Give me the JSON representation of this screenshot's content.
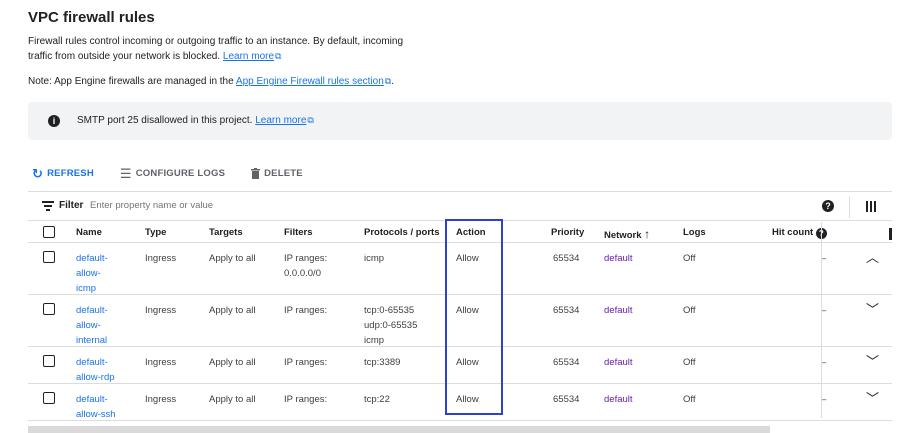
{
  "page": {
    "title": "VPC firewall rules",
    "description": "Firewall rules control incoming or outgoing traffic to an instance. By default, incoming traffic from outside your network is blocked.",
    "learn_more": "Learn more",
    "note_prefix": "Note: App Engine firewalls are managed in the",
    "note_link": "App Engine Firewall rules section",
    "note_suffix": "."
  },
  "banner": {
    "icon": "info-icon",
    "text": "SMTP port 25 disallowed in this project.",
    "link": "Learn more"
  },
  "toolbar": {
    "refresh": "REFRESH",
    "configure_logs": "CONFIGURE LOGS",
    "delete": "DELETE"
  },
  "filter": {
    "label": "Filter",
    "placeholder": "Enter property name or value"
  },
  "table": {
    "headers": {
      "name": "Name",
      "type": "Type",
      "targets": "Targets",
      "filters": "Filters",
      "protocols": "Protocols / ports",
      "action": "Action",
      "priority": "Priority",
      "network": "Network",
      "logs": "Logs",
      "hit_count": "Hit count"
    },
    "sort": {
      "column": "Network",
      "direction": "ascending",
      "icon": "arrow-up-icon"
    },
    "rows": [
      {
        "name1": "default-",
        "name2": "allow-",
        "name3": "icmp",
        "type": "Ingress",
        "targets": "Apply to all",
        "filters1": "IP ranges:",
        "filters2": "0.0.0.0/0",
        "proto1": "icmp",
        "proto2": "",
        "proto3": "",
        "action": "Allow",
        "priority": "65534",
        "network": "default",
        "logs": "Off",
        "hits": "–",
        "expanded": true
      },
      {
        "name1": "default-",
        "name2": "allow-",
        "name3": "internal",
        "type": "Ingress",
        "targets": "Apply to all",
        "filters1": "IP ranges:",
        "filters2": "",
        "proto1": "tcp:0-65535",
        "proto2": "udp:0-65535",
        "proto3": "icmp",
        "action": "Allow",
        "priority": "65534",
        "network": "default",
        "logs": "Off",
        "hits": "–",
        "expanded": false
      },
      {
        "name1": "default-",
        "name2": "allow-rdp",
        "name3": "",
        "type": "Ingress",
        "targets": "Apply to all",
        "filters1": "IP ranges:",
        "filters2": "",
        "proto1": "tcp:3389",
        "proto2": "",
        "proto3": "",
        "action": "Allow",
        "priority": "65534",
        "network": "default",
        "logs": "Off",
        "hits": "–",
        "expanded": false
      },
      {
        "name1": "default-",
        "name2": "allow-ssh",
        "name3": "",
        "type": "Ingress",
        "targets": "Apply to all",
        "filters1": "IP ranges:",
        "filters2": "",
        "proto1": "tcp:22",
        "proto2": "",
        "proto3": "",
        "action": "Allow",
        "priority": "65534",
        "network": "default",
        "logs": "Off",
        "hits": "–",
        "expanded": false
      }
    ]
  },
  "colors": {
    "link": "#1a73e8",
    "visited_link": "#681da8",
    "highlight_box": "#2f3fcf",
    "banner_bg": "#f1f3f4"
  }
}
